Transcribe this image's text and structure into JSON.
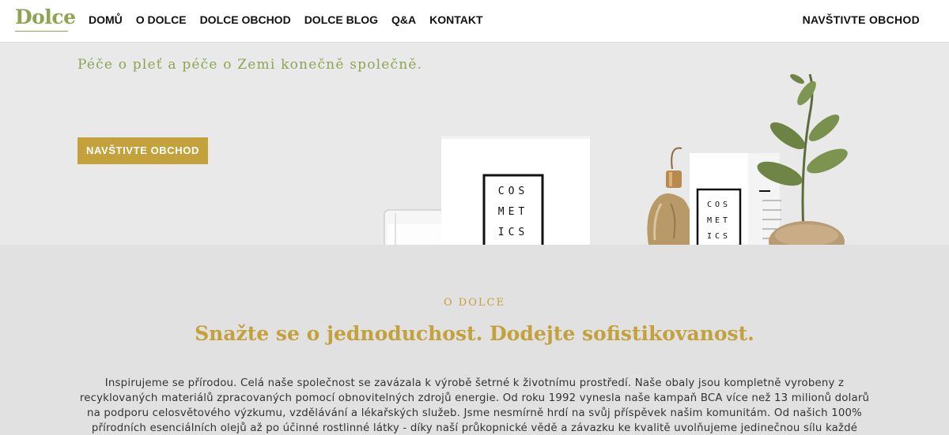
{
  "nav": {
    "logo": "Dolce",
    "items": [
      "DOMŮ",
      "O DOLCE",
      "DOLCE OBCHOD",
      "DOLCE BLOG",
      "Q&A",
      "KONTAKT"
    ],
    "shop_link": "NAVŠTIVTE OBCHOD"
  },
  "hero": {
    "subtitle": "Péče o pleť a péče o Zemi konečně společně.",
    "button": "NAVŠTIVTE OBCHOD",
    "box_label_large": [
      "COS",
      "MET",
      "ICS"
    ],
    "box_label_small": [
      "COS",
      "MET",
      "ICS"
    ]
  },
  "about": {
    "kicker": "O DOLCE",
    "title": "Snažte se o jednoduchost. Dodejte sofistikovanost.",
    "text": "Inspirujeme se přírodou. Celá naše společnost se zavázala k výrobě šetrné k životnímu prostředí. Naše obaly jsou kompletně vyrobeny z recyklovaných materiálů zpracovaných pomocí obnovitelných zdrojů energie. Od roku 1992 vynesla naše kampaň BCA více než 13 milionů dolarů na podporu celosvětového výzkumu, vzdělávání a lékařských služeb. Jsme nesmírně hrdí na svůj příspěvek našim komunitám. Od našich 100% přírodních esenciálních olejů až po účinné rostlinné látky - díky naší průkopnické vědě a závazku ke kvalitě uvolňujeme jedinečnou sílu každé složky."
  },
  "colors": {
    "brand_green": "#8da452",
    "accent_gold": "#c3a13d"
  }
}
